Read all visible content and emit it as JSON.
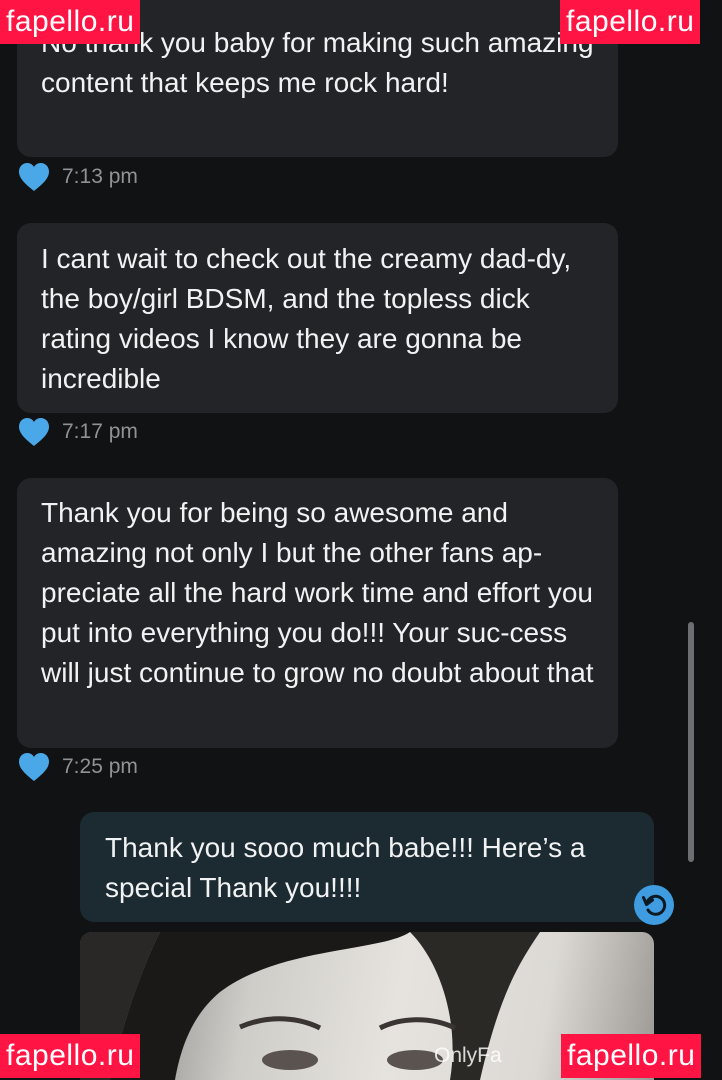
{
  "messages": [
    {
      "direction": "incoming",
      "text": "No thank you baby for making such amazing content that keeps me rock hard!",
      "time": "7:13 pm",
      "liked": true
    },
    {
      "direction": "incoming",
      "text": "I cant wait to check out the creamy dad-dy, the boy/girl BDSM, and the topless dick rating videos I know they are gonna be incredible",
      "time": "7:17 pm",
      "liked": true
    },
    {
      "direction": "incoming",
      "text": "Thank you for being so awesome and amazing not only I but the other fans ap-preciate all the hard work time and effort you put into everything you do!!! Your suc-cess will just continue to grow no doubt about that",
      "time": "7:25 pm",
      "liked": true
    },
    {
      "direction": "outgoing",
      "text": "Thank you sooo much babe!!! Here’s a special Thank you!!!!"
    }
  ],
  "media": {
    "watermark": "OnlyFa"
  },
  "overlay": {
    "watermark": "fapello.ru"
  },
  "icons": {
    "like": "heart-icon",
    "undo": "undo-icon"
  },
  "colors": {
    "background": "#111213",
    "incoming_bubble": "#232427",
    "outgoing_bubble": "#1c2b31",
    "heart": "#4aa8e8",
    "undo_button": "#3f9ce0",
    "watermark_badge": "#ff1444"
  }
}
